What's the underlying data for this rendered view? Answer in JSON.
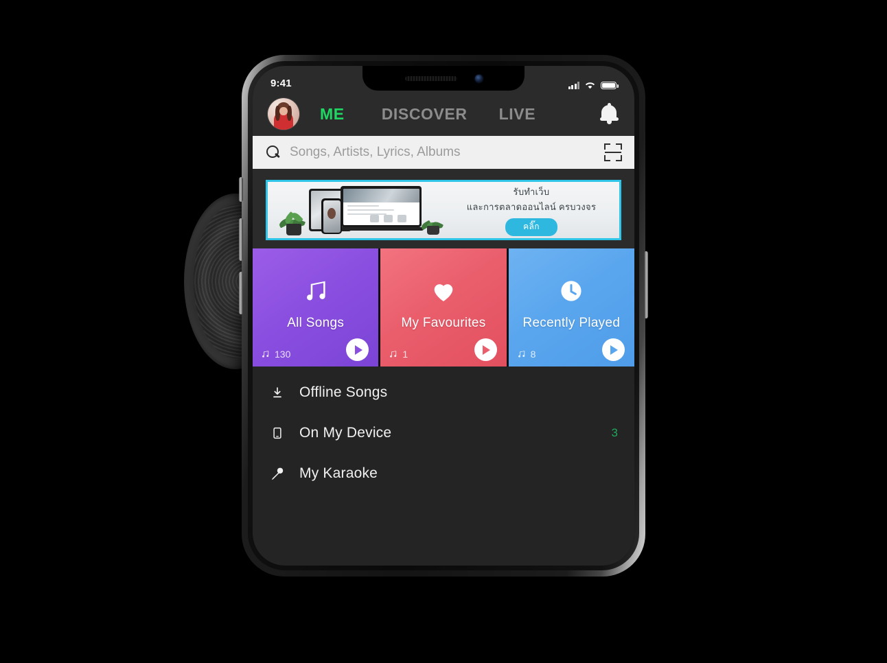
{
  "status_bar": {
    "time": "9:41",
    "signal_icon": "cellular-signal-icon",
    "wifi_icon": "wifi-icon",
    "battery_icon": "battery-icon"
  },
  "app_bar": {
    "avatar": "user-avatar",
    "tabs": [
      {
        "label": "ME",
        "active": true
      },
      {
        "label": "DISCOVER",
        "active": false
      },
      {
        "label": "LIVE",
        "active": false
      }
    ],
    "notification_icon": "bell-icon",
    "active_color": "#1fd864",
    "inactive_color": "#8c8c8c"
  },
  "search": {
    "placeholder": "Songs, Artists, Lyrics, Albums",
    "search_icon": "search-icon",
    "scan_icon": "scan-qr-icon"
  },
  "banner": {
    "line1": "รับทำเว็บ",
    "line2": "และการตลาดออนไลน์ ครบวงจร",
    "button_label": "คลิ๊ก",
    "border_color": "#2ec5e8",
    "button_color": "#2eb8e0"
  },
  "cards": [
    {
      "title": "All Songs",
      "count": "130",
      "icon": "music-note-icon",
      "color": "#8b4fe0",
      "play_icon": "play-icon"
    },
    {
      "title": "My Favourites",
      "count": "1",
      "icon": "heart-icon",
      "color": "#ea5e6c",
      "play_icon": "play-icon"
    },
    {
      "title": "Recently Played",
      "count": "8",
      "icon": "clock-icon",
      "color": "#5aa6ee",
      "play_icon": "play-icon"
    }
  ],
  "list": [
    {
      "label": "Offline Songs",
      "icon": "download-icon",
      "badge": ""
    },
    {
      "label": "On My Device",
      "icon": "device-icon",
      "badge": "3"
    },
    {
      "label": "My Karaoke",
      "icon": "microphone-icon",
      "badge": ""
    }
  ],
  "theme": {
    "background": "#000000",
    "screen_background": "#2b2b2b",
    "list_background": "#242424",
    "badge_color": "#1fa85a"
  }
}
